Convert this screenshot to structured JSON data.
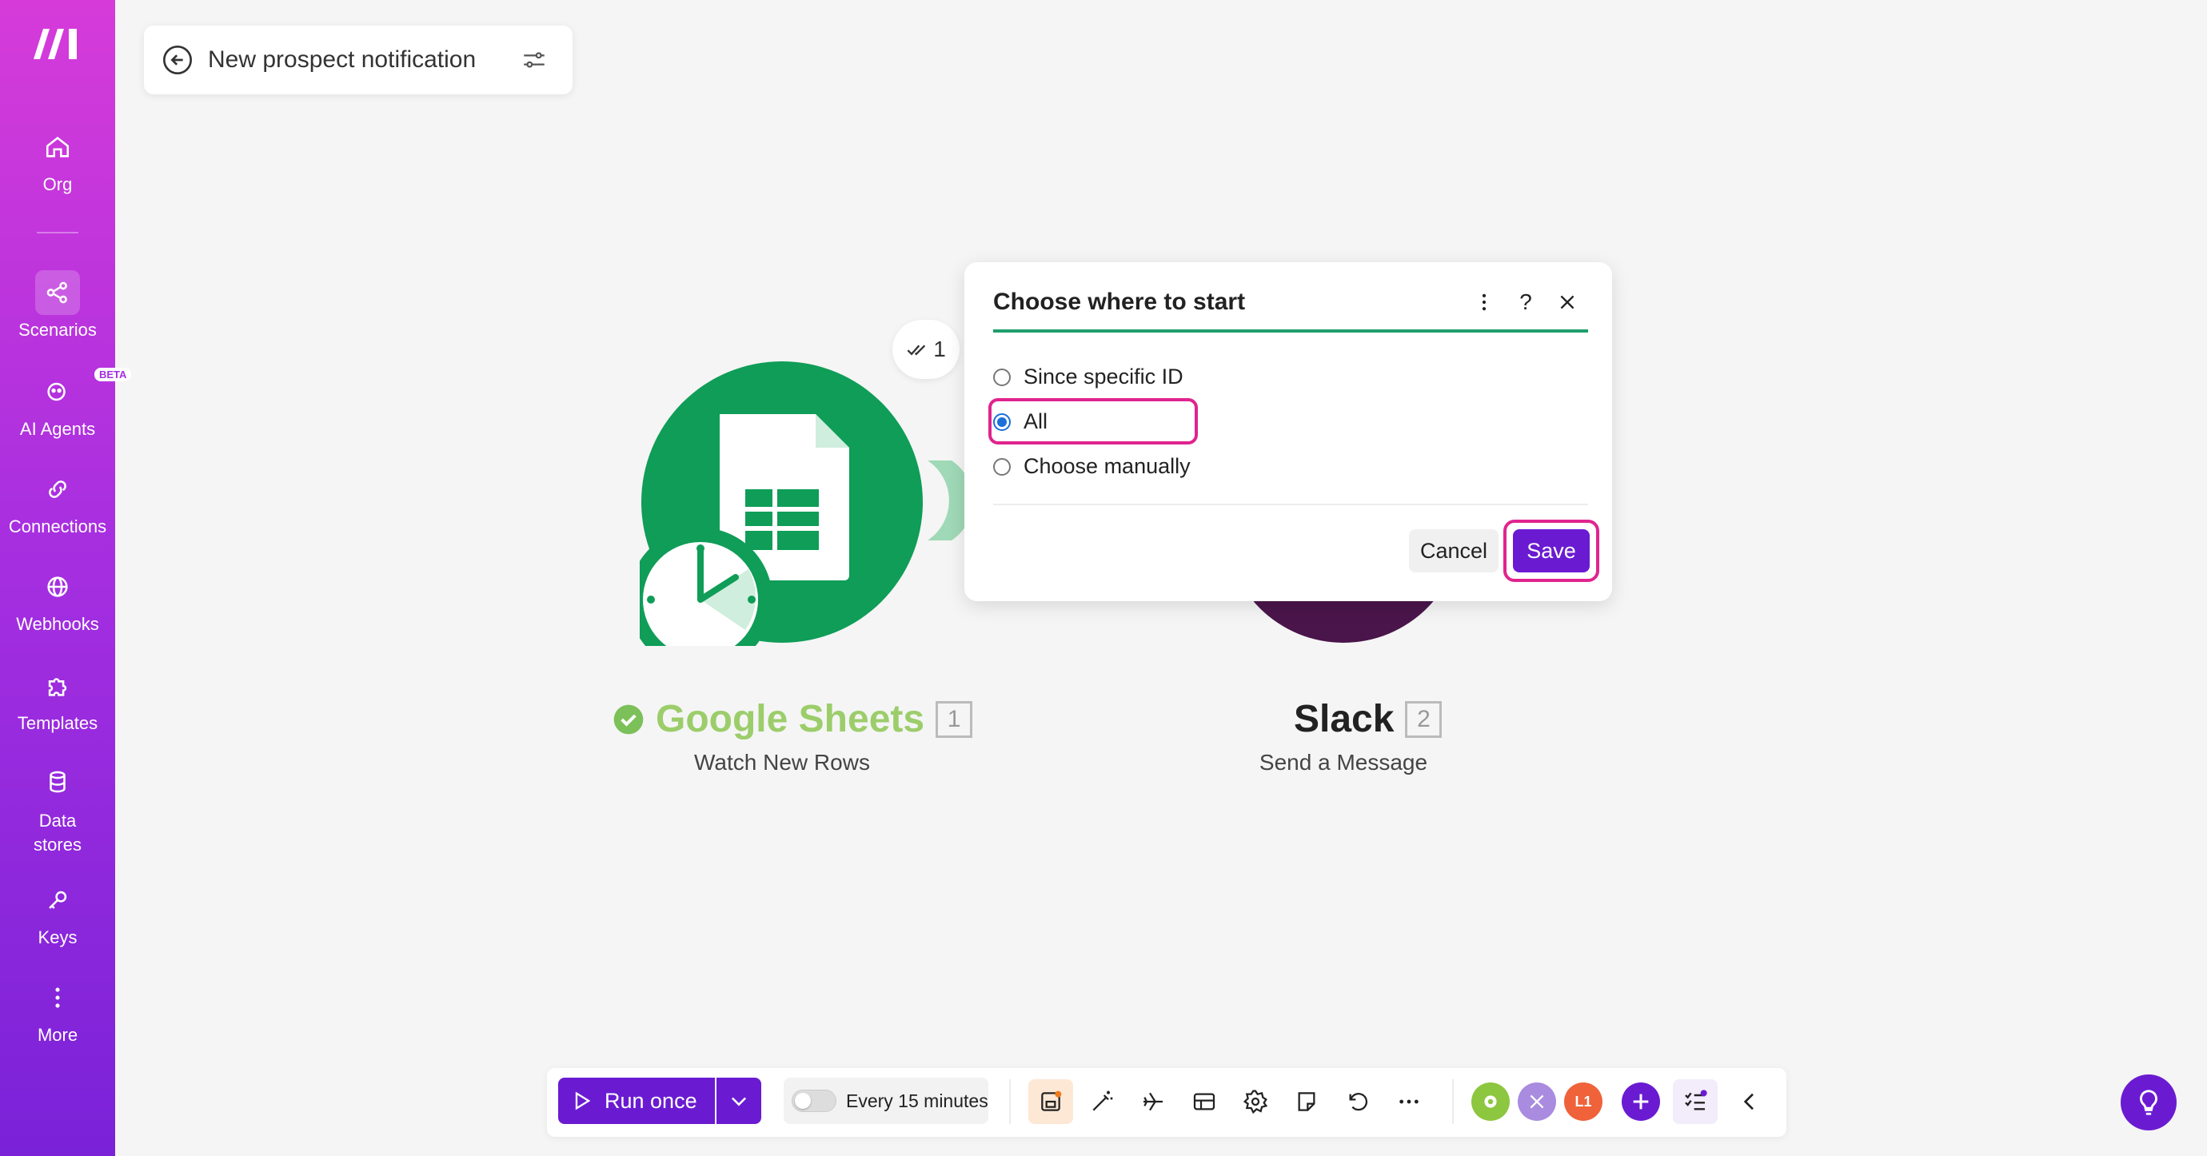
{
  "sidebar": {
    "items": [
      {
        "label": "Org"
      },
      {
        "label": "Scenarios"
      },
      {
        "label": "AI Agents",
        "badge": "BETA"
      },
      {
        "label": "Connections"
      },
      {
        "label": "Webhooks"
      },
      {
        "label": "Templates"
      },
      {
        "label": "Data stores"
      },
      {
        "label": "Keys"
      },
      {
        "label": "More"
      }
    ]
  },
  "scenario": {
    "title": "New prospect notification",
    "operations_count": "1"
  },
  "modules": [
    {
      "name": "Google Sheets",
      "number": "1",
      "action": "Watch New Rows",
      "color": "#0f9d58",
      "label_color": "#9ccd6b"
    },
    {
      "name": "Slack",
      "number": "2",
      "action": "Send a Message",
      "color": "#4a154b",
      "label_color": "#222222"
    }
  ],
  "dialog": {
    "title": "Choose where to start",
    "options": [
      {
        "label": "Since specific ID",
        "checked": false
      },
      {
        "label": "All",
        "checked": true
      },
      {
        "label": "Choose manually",
        "checked": false
      }
    ],
    "cancel_label": "Cancel",
    "save_label": "Save",
    "help_label": "?"
  },
  "toolbar": {
    "run_label": "Run once",
    "schedule_label": "Every 15 minutes",
    "app_badge_label": "L1"
  },
  "colors": {
    "accent": "#6a1bd1",
    "highlight": "#e0248e",
    "divider_green": "#1f9e6b"
  }
}
